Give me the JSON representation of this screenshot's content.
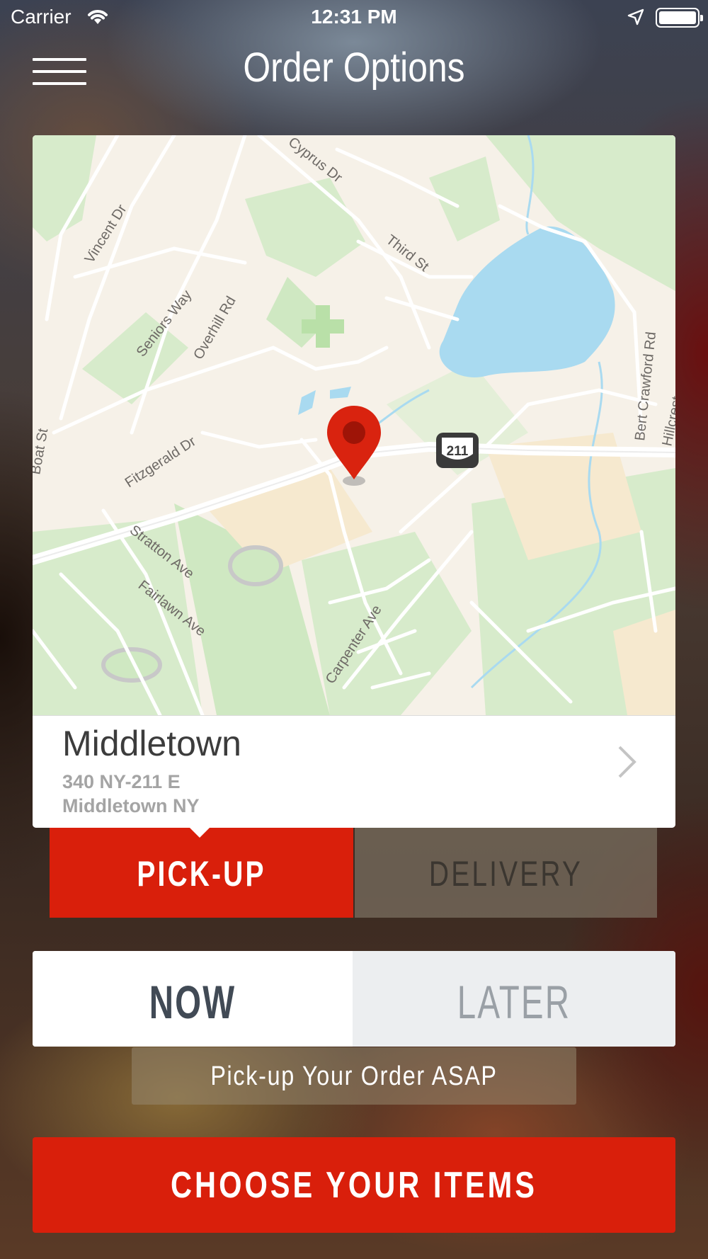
{
  "status_bar": {
    "carrier": "Carrier",
    "time": "12:31 PM",
    "icons": [
      "wifi-icon",
      "location-arrow-icon",
      "battery-icon"
    ]
  },
  "header": {
    "title": "Order Options",
    "menu_icon": "hamburger-menu-icon"
  },
  "map": {
    "street_labels": [
      "Cyprus Dr",
      "Vincent Dr",
      "Third St",
      "Seniors Way",
      "Overhill Rd",
      "Bert Crawford Rd",
      "Hillcrest",
      "Fitzgerald Dr",
      "Stratton Ave",
      "Fairlawn Ave",
      "Carpenter Ave",
      "Boat St"
    ],
    "route_shield": "211",
    "pin_icon": "map-pin-icon",
    "colors": {
      "land": "#f6f1e8",
      "park": "#cfe8c2",
      "water": "#a9daf0",
      "road": "#ffffff",
      "pin": "#d9230f"
    }
  },
  "location": {
    "name": "Middletown",
    "street": "340 NY-211 E",
    "city": "Middletown NY"
  },
  "service_toggle": {
    "pickup_label": "PICK-UP",
    "delivery_label": "DELIVERY",
    "selected": "PICK-UP"
  },
  "time_toggle": {
    "now_label": "NOW",
    "later_label": "LATER",
    "selected": "NOW"
  },
  "asap_note": "Pick-up Your Order ASAP",
  "cta_label": "CHOOSE YOUR ITEMS",
  "colors": {
    "accent": "#d91f0b",
    "text_dark": "#414a55"
  }
}
